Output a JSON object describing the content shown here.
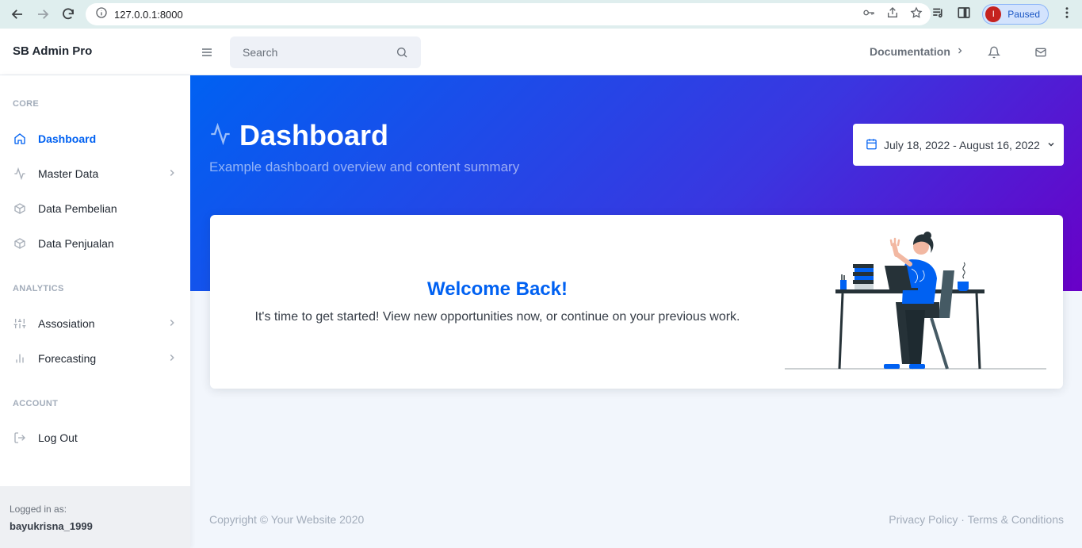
{
  "browser": {
    "url": "127.0.0.1:8000",
    "profile_initial": "I",
    "profile_status": "Paused"
  },
  "topnav": {
    "brand": "SB Admin Pro",
    "search_placeholder": "Search",
    "docs_label": "Documentation"
  },
  "sidebar": {
    "sections": [
      {
        "heading": "CORE"
      },
      {
        "heading": "ANALYTICS"
      },
      {
        "heading": "ACCOUNT"
      }
    ],
    "items": [
      {
        "label": "Dashboard",
        "icon": "home-icon",
        "active": true
      },
      {
        "label": "Master Data",
        "icon": "activity-icon",
        "has_children": true
      },
      {
        "label": "Data Pembelian",
        "icon": "package-icon"
      },
      {
        "label": "Data Penjualan",
        "icon": "package-icon"
      },
      {
        "label": "Assosiation",
        "icon": "sliders-icon",
        "has_children": true
      },
      {
        "label": "Forecasting",
        "icon": "bar-chart-icon",
        "has_children": true
      },
      {
        "label": "Log Out",
        "icon": "log-out-icon"
      }
    ],
    "footer": {
      "label": "Logged in as:",
      "username": "bayukrisna_1999"
    }
  },
  "header": {
    "title": "Dashboard",
    "subtitle": "Example dashboard overview and content summary",
    "date_range": "July 18, 2022 - August 16, 2022"
  },
  "welcome": {
    "title": "Welcome Back!",
    "text": "It's time to get started! View new opportunities now, or continue on your previous work."
  },
  "footer": {
    "copyright": "Copyright © Your Website 2020",
    "privacy": "Privacy Policy",
    "separator": "·",
    "terms": "Terms & Conditions"
  },
  "colors": {
    "primary": "#0061f2",
    "gradient_end": "#6900c7",
    "sidebar_bg": "#ffffff",
    "page_bg": "#f2f6fc"
  }
}
